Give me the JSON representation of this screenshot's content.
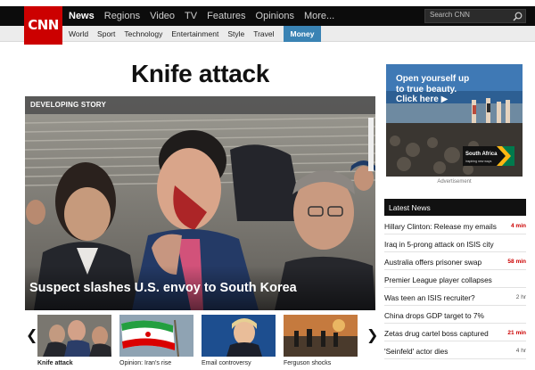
{
  "header": {
    "logo": "CNN",
    "main_nav": [
      "News",
      "Regions",
      "Video",
      "TV",
      "Features",
      "Opinions",
      "More..."
    ],
    "active_main": "News",
    "search_placeholder": "Search CNN",
    "sub_nav": [
      "World",
      "Sport",
      "Technology",
      "Entertainment",
      "Style",
      "Travel",
      "Money"
    ],
    "active_sub": "Money"
  },
  "story": {
    "headline": "Knife attack",
    "badge": "DEVELOPING STORY",
    "caption": "Suspect slashes U.S. envoy to South Korea"
  },
  "carousel": {
    "items": [
      {
        "label": "Knife attack"
      },
      {
        "label": "Opinion: Iran's rise"
      },
      {
        "label": "Email controversy"
      },
      {
        "label": "Ferguson shocks"
      }
    ],
    "active_index": 0
  },
  "ad": {
    "line1": "Open yourself up",
    "line2": "to true beauty.",
    "cta": "Click here",
    "badge_text": "South Africa",
    "badge_tagline": "inspiring new ways",
    "label": "Advertisement"
  },
  "latest_news": {
    "title": "Latest News",
    "items": [
      {
        "text": "Hillary Clinton: Release my emails",
        "meta": "4 min",
        "fresh": true
      },
      {
        "text": "Iraq in 5-prong attack on ISIS city",
        "meta": "",
        "fresh": false
      },
      {
        "text": "Australia offers prisoner swap",
        "meta": "58 min",
        "fresh": true
      },
      {
        "text": "Premier League player collapses",
        "meta": "",
        "fresh": false
      },
      {
        "text": "Was teen an ISIS recruiter?",
        "meta": "2 hr",
        "fresh": false
      },
      {
        "text": "China drops GDP target to 7%",
        "meta": "",
        "fresh": false
      },
      {
        "text": "Zetas drug cartel boss captured",
        "meta": "21 min",
        "fresh": true
      },
      {
        "text": "'Seinfeld' actor dies",
        "meta": "4 hr",
        "fresh": false
      }
    ]
  },
  "colors": {
    "brand_red": "#cc0000",
    "nav_black": "#0c0c0c",
    "money_blue": "#3a83b4"
  }
}
